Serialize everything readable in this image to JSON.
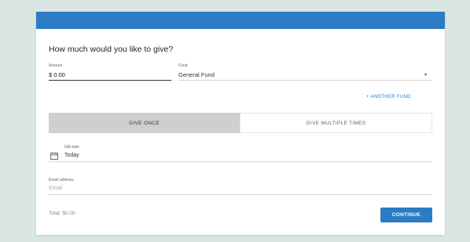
{
  "form": {
    "title": "How much would you like to give?",
    "amount_label": "Amount",
    "amount_value": "$ 0.00",
    "fund_label": "Fund",
    "fund_value": "General Fund",
    "another_fund_link": "+ ANOTHER FUND",
    "tabs": [
      "GIVE ONCE",
      "GIVE MULTIPLE TIMES"
    ],
    "active_tab": "GIVE ONCE",
    "gift_date_label": "Gift date",
    "gift_date_value": "Today",
    "email_label": "Email address",
    "email_placeholder": "Email",
    "total": "Total: $0.00",
    "continue_label": "CONTINUE"
  },
  "colors": {
    "header": "#2b7cc4",
    "button": "#2b7cc4",
    "active_tab": "#cfcfcf",
    "background": "#d9e6e4"
  },
  "icons": {
    "calendar": "calendar-icon",
    "dropdown": "caret-down-icon"
  }
}
